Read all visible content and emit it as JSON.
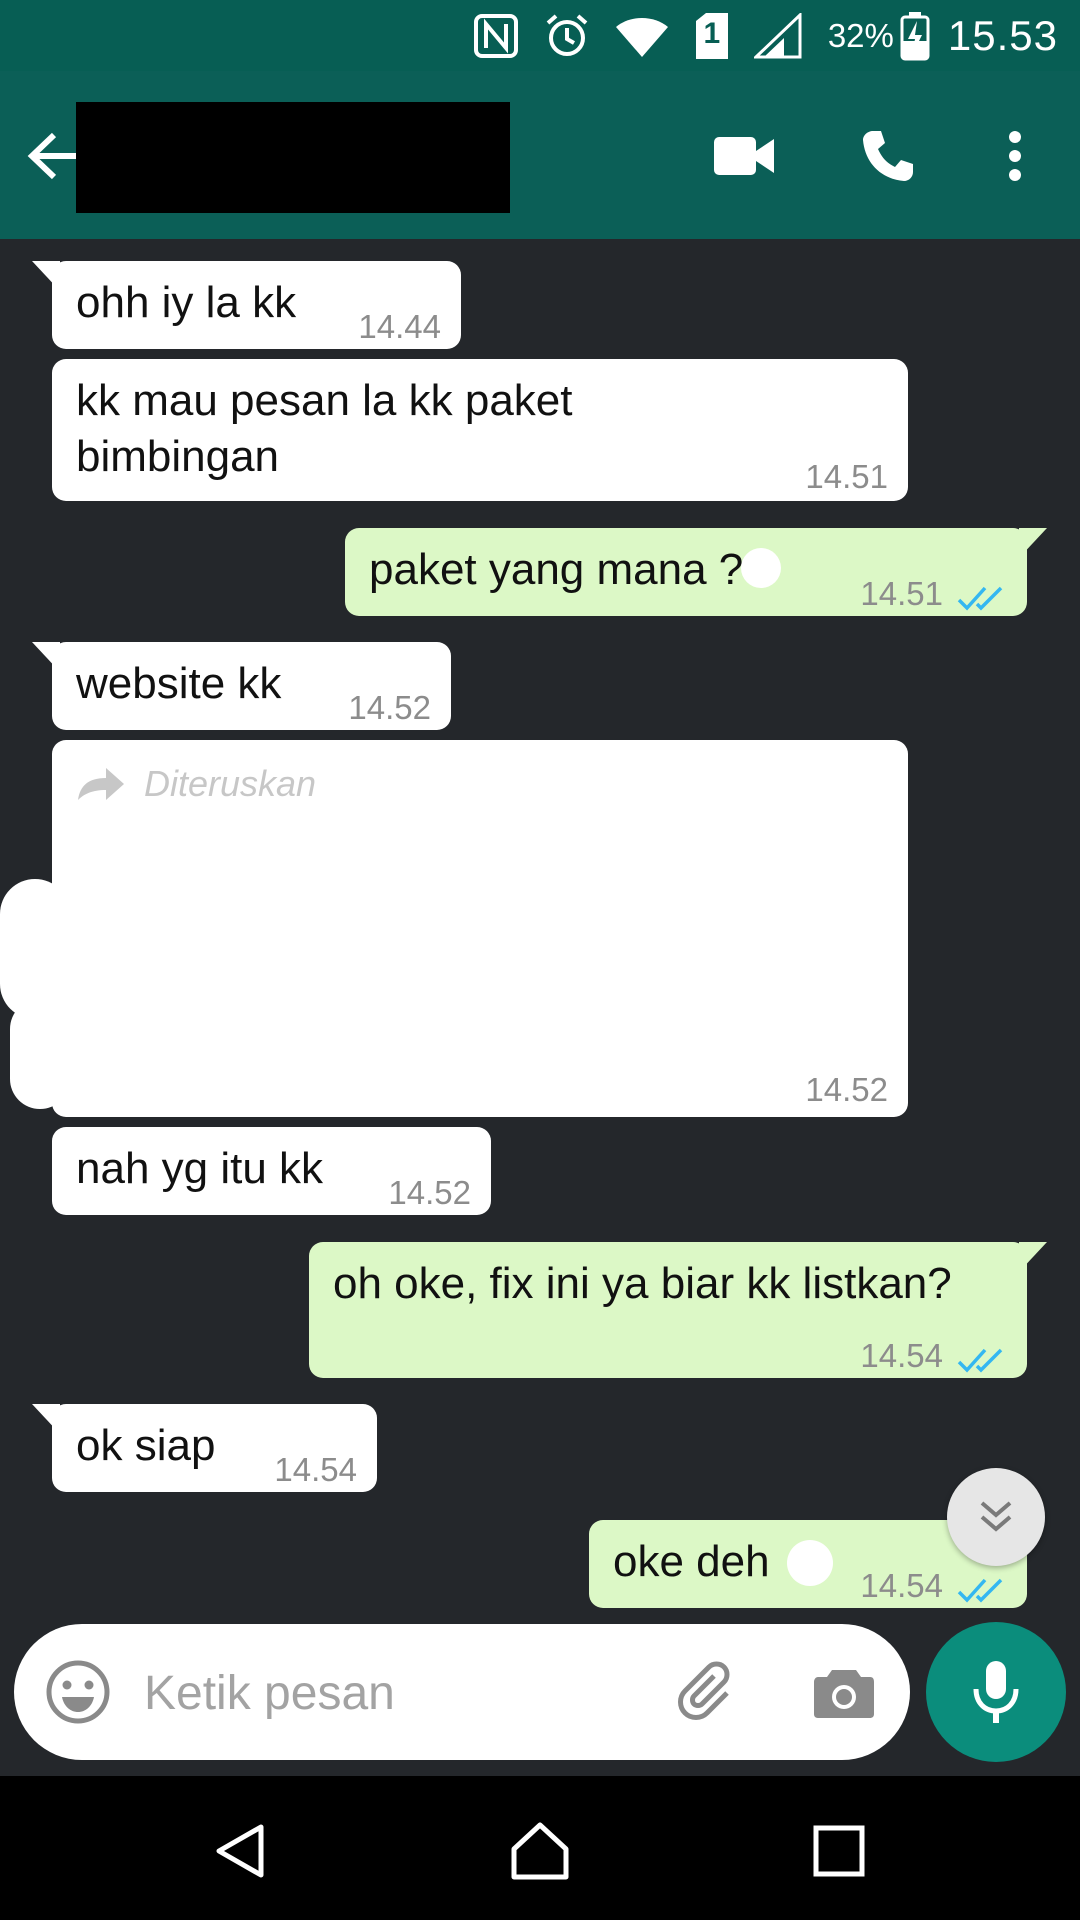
{
  "status_bar": {
    "battery_percent": "32%",
    "time": "15.53",
    "sim_slot": "1",
    "icons": [
      "nfc-icon",
      "alarm-icon",
      "wifi-icon",
      "sim-icon",
      "signal-icon",
      "battery-charging-icon"
    ]
  },
  "app_bar": {
    "icons": [
      "back-arrow-icon",
      "video-call-icon",
      "phone-icon",
      "more-vert-icon"
    ]
  },
  "messages": [
    {
      "direction": "in",
      "text": "ohh iy la kk",
      "time": "14.44"
    },
    {
      "direction": "in",
      "text": "kk        mau pesan la kk paket\nbimbingan",
      "time": "14.51"
    },
    {
      "direction": "out",
      "text": "paket yang mana   ??",
      "time": "14.51",
      "status": "read"
    },
    {
      "direction": "in",
      "text": "website kk",
      "time": "14.52"
    },
    {
      "direction": "in",
      "forwarded_label": "Diteruskan",
      "text": "",
      "time": "14.52"
    },
    {
      "direction": "in",
      "text": "nah yg itu kk",
      "time": "14.52"
    },
    {
      "direction": "out",
      "text": "oh oke, fix ini ya biar kk listkan?",
      "time": "14.54",
      "status": "read"
    },
    {
      "direction": "in",
      "text": "ok siap",
      "time": "14.54"
    },
    {
      "direction": "out",
      "text": "oke deh",
      "time": "14.54",
      "status": "read"
    }
  ],
  "composer": {
    "placeholder": "Ketik pesan",
    "value": "",
    "icons": [
      "emoji-icon",
      "attach-icon",
      "camera-icon",
      "mic-icon"
    ]
  },
  "colors": {
    "header": "#075e54",
    "incoming_bubble": "#ffffff",
    "outgoing_bubble": "#dcf8c6",
    "read_ticks": "#34b7f1",
    "chat_background": "#24272b",
    "mic_button": "#0b8d7c"
  }
}
